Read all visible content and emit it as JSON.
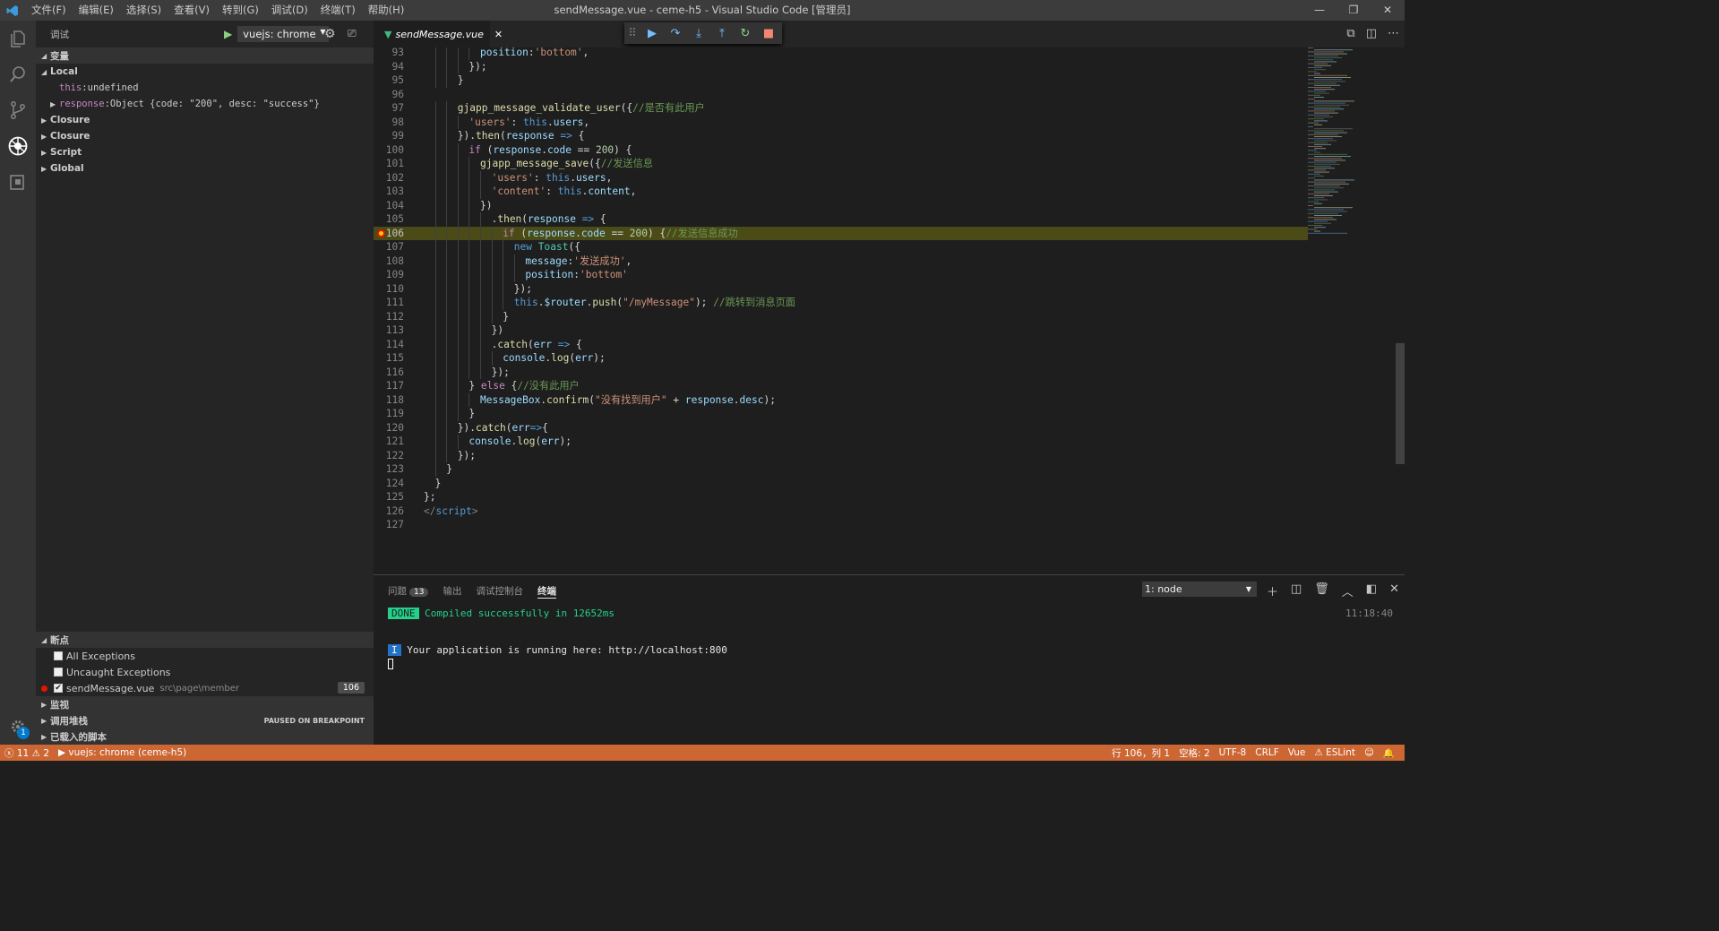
{
  "window": {
    "title": "sendMessage.vue - ceme-h5 - Visual Studio Code [管理员]",
    "menu": [
      "文件(F)",
      "编辑(E)",
      "选择(S)",
      "查看(V)",
      "转到(G)",
      "调试(D)",
      "终端(T)",
      "帮助(H)"
    ],
    "controls": [
      "—",
      "❐",
      "✕"
    ]
  },
  "activity": {
    "icons": [
      "files-icon",
      "search-icon",
      "source-control-icon",
      "debug-icon",
      "extensions-icon"
    ],
    "settings_badge": "1"
  },
  "sidebar": {
    "title": "调试",
    "launch_config": "vuejs: chrome",
    "variables_header": "变量",
    "local_scope": "Local",
    "vars": [
      {
        "name": "this",
        "value": "undefined"
      },
      {
        "name": "response",
        "value": "Object {code: \"200\", desc: \"success\"}"
      }
    ],
    "scopes": [
      "Closure",
      "Closure",
      "Script",
      "Global"
    ],
    "breakpoints_header": "断点",
    "breakpoints": [
      {
        "label": "All Exceptions",
        "checked": false
      },
      {
        "label": "Uncaught Exceptions",
        "checked": false
      }
    ],
    "bp_file": {
      "name": "sendMessage.vue",
      "path": "src\\page\\member",
      "line": "106"
    },
    "watch_header": "监视",
    "callstack_header": "调用堆栈",
    "paused_label": "PAUSED ON BREAKPOINT",
    "loaded_scripts_header": "已载入的脚本"
  },
  "editor": {
    "tab_name": "sendMessage.vue",
    "current_line": 106,
    "lines": [
      {
        "n": "93",
        "indent": 5,
        "html": "<span class='v'>position</span><span class='p'>:</span><span class='s'>'bottom'</span><span class='p'>,</span>"
      },
      {
        "n": "94",
        "indent": 4,
        "html": "<span class='p'>});</span>"
      },
      {
        "n": "95",
        "indent": 3,
        "html": "<span class='p'>}</span>"
      },
      {
        "n": "96",
        "indent": 0,
        "html": ""
      },
      {
        "n": "97",
        "indent": 3,
        "html": "<span class='f'>gjapp_message_validate_user</span><span class='p'>({</span><span class='c'>//是否有此用户</span>"
      },
      {
        "n": "98",
        "indent": 4,
        "html": "<span class='s'>'users'</span><span class='p'>: </span><span class='k'>this</span><span class='p'>.</span><span class='v'>users</span><span class='p'>,</span>"
      },
      {
        "n": "99",
        "indent": 3,
        "html": "<span class='p'>}).</span><span class='f'>then</span><span class='p'>(</span><span class='v'>response</span> <span class='k'>=&gt;</span> <span class='p'>{</span>"
      },
      {
        "n": "100",
        "indent": 4,
        "html": "<span class='kc'>if</span> <span class='p'>(</span><span class='v'>response</span><span class='p'>.</span><span class='v'>code</span> <span class='p'>==</span> <span class='n'>200</span><span class='p'>) {</span>"
      },
      {
        "n": "101",
        "indent": 5,
        "html": "<span class='f'>gjapp_message_save</span><span class='p'>({</span><span class='c'>//发送信息</span>"
      },
      {
        "n": "102",
        "indent": 6,
        "html": "<span class='s'>'users'</span><span class='p'>: </span><span class='k'>this</span><span class='p'>.</span><span class='v'>users</span><span class='p'>,</span>"
      },
      {
        "n": "103",
        "indent": 6,
        "html": "<span class='s'>'content'</span><span class='p'>: </span><span class='k'>this</span><span class='p'>.</span><span class='v'>content</span><span class='p'>,</span>"
      },
      {
        "n": "104",
        "indent": 5,
        "html": "<span class='p'>})</span>"
      },
      {
        "n": "105",
        "indent": 6,
        "html": "<span class='p'>.</span><span class='f'>then</span><span class='p'>(</span><span class='v'>response</span> <span class='k'>=&gt;</span> <span class='p'>{</span>"
      },
      {
        "n": "106",
        "indent": 7,
        "html": "<span class='kc'>if</span> <span class='p'>(</span><span class='v'>response</span><span class='p'>.</span><span class='v'>code</span> <span class='p'>==</span> <span class='n'>200</span><span class='p'>) {</span><span class='c'>//发送信息成功</span>"
      },
      {
        "n": "107",
        "indent": 8,
        "html": "<span class='k'>new</span> <span class='t'>Toast</span><span class='p'>({</span>"
      },
      {
        "n": "108",
        "indent": 9,
        "html": "<span class='v'>message</span><span class='p'>:</span><span class='s'>'发送成功'</span><span class='p'>,</span>"
      },
      {
        "n": "109",
        "indent": 9,
        "html": "<span class='v'>position</span><span class='p'>:</span><span class='s'>'bottom'</span>"
      },
      {
        "n": "110",
        "indent": 8,
        "html": "<span class='p'>});</span>"
      },
      {
        "n": "111",
        "indent": 8,
        "html": "<span class='k'>this</span><span class='p'>.</span><span class='v'>$router</span><span class='p'>.</span><span class='f'>push</span><span class='p'>(</span><span class='s'>\"/myMessage\"</span><span class='p'>); </span><span class='c'>//跳转到消息页面</span>"
      },
      {
        "n": "112",
        "indent": 7,
        "html": "<span class='p'>}</span>"
      },
      {
        "n": "113",
        "indent": 6,
        "html": "<span class='p'>})</span>"
      },
      {
        "n": "114",
        "indent": 6,
        "html": "<span class='p'>.</span><span class='f'>catch</span><span class='p'>(</span><span class='v'>err</span> <span class='k'>=&gt;</span> <span class='p'>{</span>"
      },
      {
        "n": "115",
        "indent": 7,
        "html": "<span class='v'>console</span><span class='p'>.</span><span class='f'>log</span><span class='p'>(</span><span class='v'>err</span><span class='p'>);</span>"
      },
      {
        "n": "116",
        "indent": 6,
        "html": "<span class='p'>});</span>"
      },
      {
        "n": "117",
        "indent": 4,
        "html": "<span class='p'>} </span><span class='kc'>else</span> <span class='p'>{</span><span class='c'>//没有此用户</span>"
      },
      {
        "n": "118",
        "indent": 5,
        "html": "<span class='v'>MessageBox</span><span class='p'>.</span><span class='f'>confirm</span><span class='p'>(</span><span class='s'>\"没有找到用户\"</span> <span class='p'>+</span> <span class='v'>response</span><span class='p'>.</span><span class='v'>desc</span><span class='p'>);</span>"
      },
      {
        "n": "119",
        "indent": 4,
        "html": "<span class='p'>}</span>"
      },
      {
        "n": "120",
        "indent": 3,
        "html": "<span class='p'>}).</span><span class='f'>catch</span><span class='p'>(</span><span class='v'>err</span><span class='k'>=&gt;</span><span class='p'>{</span>"
      },
      {
        "n": "121",
        "indent": 4,
        "html": "<span class='v'>console</span><span class='p'>.</span><span class='f'>log</span><span class='p'>(</span><span class='v'>err</span><span class='p'>);</span>"
      },
      {
        "n": "122",
        "indent": 3,
        "html": "<span class='p'>});</span>"
      },
      {
        "n": "123",
        "indent": 2,
        "html": "<span class='p'>}</span>"
      },
      {
        "n": "124",
        "indent": 1,
        "html": "<span class='p'>}</span>"
      },
      {
        "n": "125",
        "indent": 0,
        "html": "<span class='p'>};</span>"
      },
      {
        "n": "126",
        "indent": 0,
        "html": "<span class='tg'>&lt;/</span><span class='k'>script</span><span class='tg'>&gt;</span>"
      },
      {
        "n": "127",
        "indent": 0,
        "html": ""
      }
    ]
  },
  "panel": {
    "tabs": [
      "问题",
      "输出",
      "调试控制台",
      "终端"
    ],
    "problems_count": "13",
    "terminal_select": "1: node",
    "done_label": "DONE",
    "compiled": "Compiled successfully in 12652ms",
    "time": "11:18:40",
    "info_label": "I",
    "running": "Your application is running here: http://localhost:800"
  },
  "statusbar": {
    "errors": "11",
    "warnings": "2",
    "debug_target": "vuejs: chrome (ceme-h5)",
    "position": "行 106，列 1",
    "spaces": "空格: 2",
    "encoding": "UTF-8",
    "eol": "CRLF",
    "language": "Vue",
    "linter": "ESLint"
  },
  "colors": {
    "statusbar": "#cc6633",
    "current_line": "#4b4b18",
    "breakpoint": "#e51400"
  }
}
